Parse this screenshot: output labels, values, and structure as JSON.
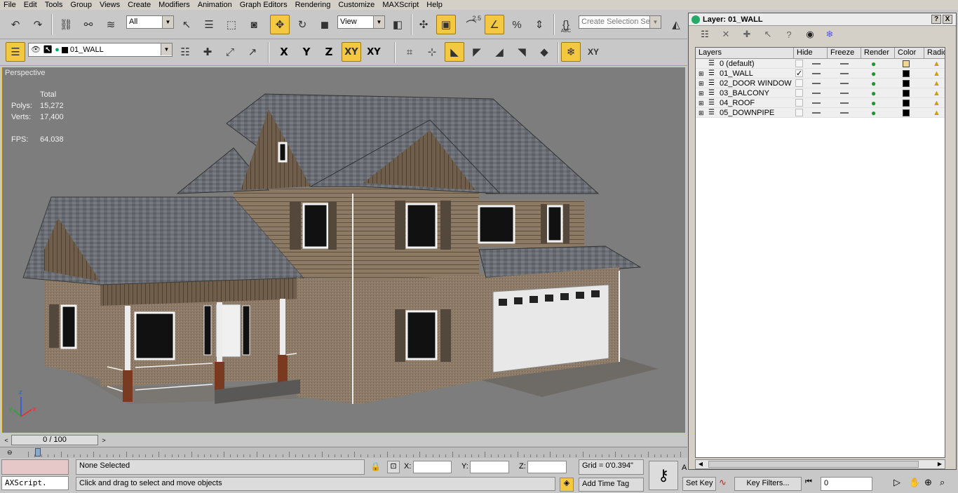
{
  "menu": [
    "File",
    "Edit",
    "Tools",
    "Group",
    "Views",
    "Create",
    "Modifiers",
    "Animation",
    "Graph Editors",
    "Rendering",
    "Customize",
    "MAXScript",
    "Help"
  ],
  "toolbar": {
    "filter_value": "All",
    "view_value": "View",
    "snap_label": "2.5",
    "selection_set_placeholder": "Create Selection Set",
    "abc_label": "ABC"
  },
  "layer_toolbar": {
    "current_layer": "01_WALL",
    "axis_x": "X",
    "axis_y": "Y",
    "axis_z": "Z",
    "axis_xy": "XY",
    "axis_xy2": "XY"
  },
  "viewport": {
    "label": "Perspective",
    "stats": {
      "total_label": "Total",
      "polys_label": "Polys:",
      "polys_value": "15,272",
      "verts_label": "Verts:",
      "verts_value": "17,400",
      "fps_label": "FPS:",
      "fps_value": "64.038"
    },
    "axis_labels": {
      "x": "x",
      "y": "y",
      "z": "z"
    }
  },
  "timeline": {
    "value": "0 / 100"
  },
  "status": {
    "selection": "None Selected",
    "prompt": "Click and drag to select and move objects",
    "maxscript": "AXScript.",
    "x_label": "X:",
    "y_label": "Y:",
    "z_label": "Z:",
    "grid": "Grid = 0'0.394\"",
    "add_time_tag": "Add Time Tag",
    "auto_letter": "A",
    "set_key": "Set Key",
    "key_filters": "Key Filters...",
    "frame_value": "0"
  },
  "layer_dialog": {
    "title": "Layer: 01_WALL",
    "help_btn": "?",
    "close_btn": "X",
    "columns": [
      "Layers",
      "Hide",
      "Freeze",
      "Render",
      "Color",
      "Radios"
    ],
    "layers": [
      {
        "name": "0 (default)",
        "active": false,
        "color": "#f0d890",
        "expand": false
      },
      {
        "name": "01_WALL",
        "active": true,
        "color": "#000000",
        "expand": true
      },
      {
        "name": "02_DOOR WINDOW",
        "active": false,
        "color": "#000000",
        "expand": true
      },
      {
        "name": "03_BALCONY",
        "active": false,
        "color": "#000000",
        "expand": true
      },
      {
        "name": "04_ROOF",
        "active": false,
        "color": "#000000",
        "expand": true
      },
      {
        "name": "05_DOWNPIPE",
        "active": false,
        "color": "#000000",
        "expand": true
      }
    ]
  }
}
